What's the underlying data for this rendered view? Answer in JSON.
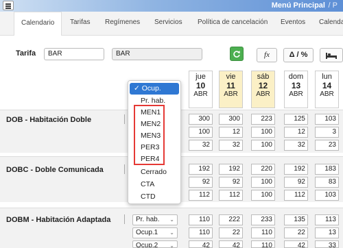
{
  "header": {
    "menu_title": "Menú Principal",
    "menu_sep": "/ P"
  },
  "tabs": [
    "Calendario",
    "Tarifas",
    "Regímenes",
    "Servicios",
    "Política de cancelación",
    "Eventos",
    "Calenda"
  ],
  "filters": {
    "tarifa_label": "Tarifa",
    "tarifa_code": "BAR",
    "tarifa_name": "BAR",
    "fx_label": "fx",
    "delta_label": "Δ / %"
  },
  "dates": [
    {
      "dow": "jue",
      "day": "10",
      "mon": "ABR"
    },
    {
      "dow": "vie",
      "day": "11",
      "mon": "ABR"
    },
    {
      "dow": "sáb",
      "day": "12",
      "mon": "ABR"
    },
    {
      "dow": "dom",
      "day": "13",
      "mon": "ABR"
    },
    {
      "dow": "lun",
      "day": "14",
      "mon": "ABR"
    }
  ],
  "rooms": [
    {
      "name": "DOB - Habitación Doble",
      "rows": [
        [
          "300",
          "300",
          "223",
          "125",
          "103"
        ],
        [
          "100",
          "12",
          "100",
          "12",
          "3"
        ],
        [
          "32",
          "32",
          "100",
          "32",
          "23"
        ]
      ]
    },
    {
      "name": "DOBC - Doble Comunicada",
      "rows": [
        [
          "192",
          "192",
          "220",
          "192",
          "183"
        ],
        [
          "92",
          "92",
          "100",
          "92",
          "83"
        ],
        [
          "112",
          "112",
          "100",
          "112",
          "103"
        ]
      ]
    },
    {
      "name": "DOBM - Habitación Adaptada",
      "selects": [
        "Pr. hab.",
        "Ocup.1",
        "Ocup.2"
      ],
      "rows": [
        [
          "110",
          "222",
          "233",
          "135",
          "113"
        ],
        [
          "110",
          "22",
          "110",
          "22",
          "13"
        ],
        [
          "42",
          "42",
          "110",
          "42",
          "33"
        ]
      ]
    }
  ],
  "dropdown": {
    "selected": "✓ Ocup.",
    "items": [
      "Pr. hab.",
      "MEN1",
      "MEN2",
      "MEN3",
      "PER3",
      "PER4",
      "Cerrado",
      "CTA",
      "CTD"
    ]
  }
}
